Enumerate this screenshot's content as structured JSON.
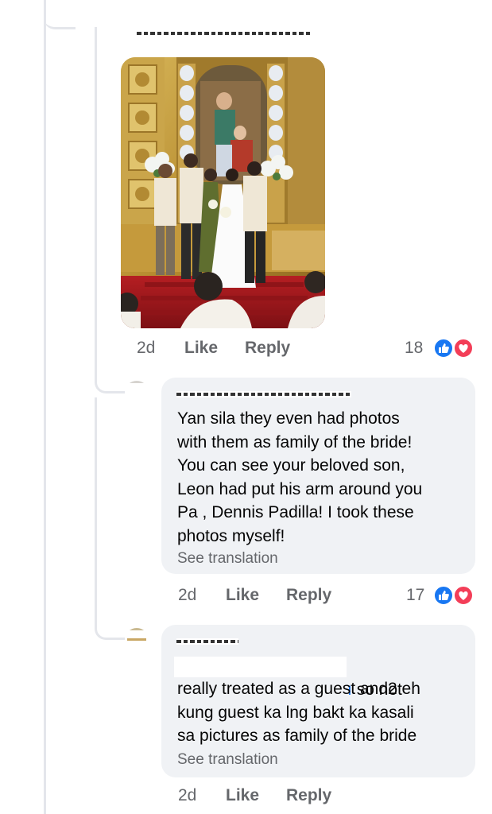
{
  "comments": [
    {
      "author": "[redacted]",
      "time": "2d",
      "like_label": "Like",
      "reply_label": "Reply",
      "reaction_count": "18",
      "reactions": [
        "like-icon",
        "love-icon"
      ],
      "has_photo": true
    },
    {
      "author": "[redacted]",
      "text": "Yan sila they even had photos\nwith them as family of the bride!\nYou can see your beloved son,\nLeon had put his arm around you\nPa , Dennis Padilla!  I took these\nphotos myself!",
      "see_translation": "See translation",
      "time": "2d",
      "like_label": "Like",
      "reply_label": "Reply",
      "reaction_count": "17",
      "reactions": [
        "like-icon",
        "love-icon"
      ]
    },
    {
      "author": "[redacted]",
      "text_first_line_visible": "so not",
      "text": "really treated as a guest and2 eh\nkung guest ka lng bakt ka kasali\nsa pictures as family of the bride",
      "see_translation": "See translation",
      "time": "2d",
      "like_label": "Like",
      "reply_label": "Reply"
    }
  ],
  "colors": {
    "bubble": "#f0f2f5",
    "meta_text": "#65676b",
    "like_blue": "#1877f2",
    "love_red": "#f33e58",
    "thread_line": "#e4e6eb"
  }
}
